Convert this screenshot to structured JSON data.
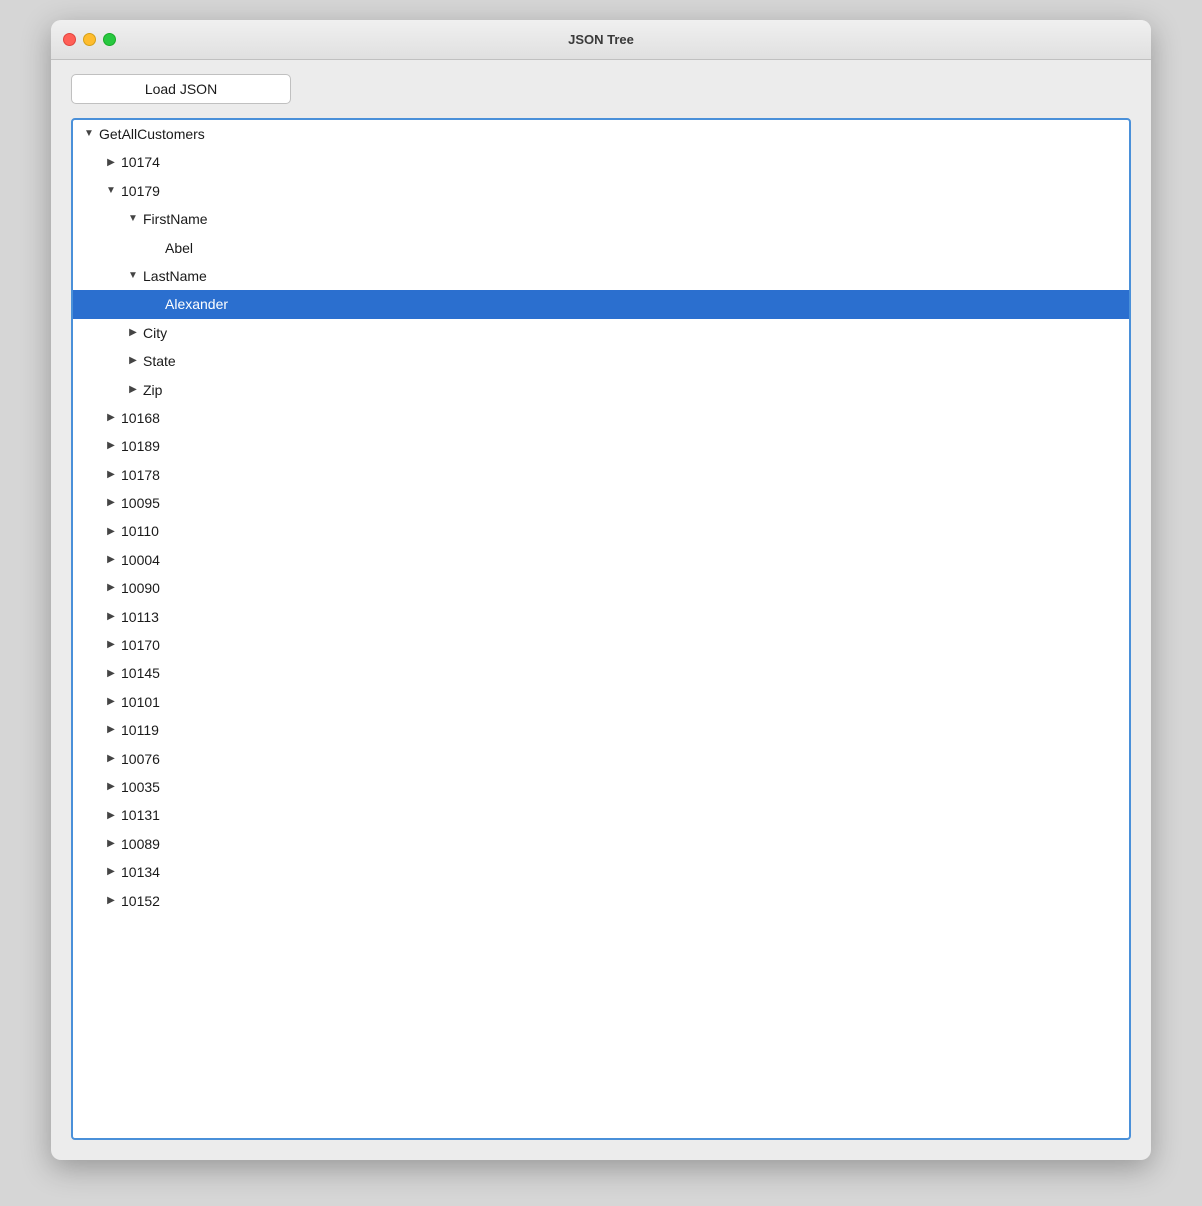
{
  "window": {
    "title": "JSON Tree"
  },
  "toolbar": {
    "load_button_label": "Load JSON"
  },
  "tree": {
    "items": [
      {
        "id": "GetAllCustomers",
        "label": "GetAllCustomers",
        "arrow": "expanded",
        "indent": 0,
        "selected": false
      },
      {
        "id": "10174",
        "label": "10174",
        "arrow": "collapsed",
        "indent": 1,
        "selected": false
      },
      {
        "id": "10179",
        "label": "10179",
        "arrow": "expanded",
        "indent": 1,
        "selected": false
      },
      {
        "id": "FirstName",
        "label": "FirstName",
        "arrow": "expanded",
        "indent": 2,
        "selected": false
      },
      {
        "id": "Abel",
        "label": "Abel",
        "arrow": "none",
        "indent": 3,
        "selected": false
      },
      {
        "id": "LastName",
        "label": "LastName",
        "arrow": "expanded",
        "indent": 2,
        "selected": false
      },
      {
        "id": "Alexander",
        "label": "Alexander",
        "arrow": "none",
        "indent": 3,
        "selected": true
      },
      {
        "id": "City",
        "label": "City",
        "arrow": "collapsed",
        "indent": 2,
        "selected": false
      },
      {
        "id": "State",
        "label": "State",
        "arrow": "collapsed",
        "indent": 2,
        "selected": false
      },
      {
        "id": "Zip",
        "label": "Zip",
        "arrow": "collapsed",
        "indent": 2,
        "selected": false
      },
      {
        "id": "10168",
        "label": "10168",
        "arrow": "collapsed",
        "indent": 1,
        "selected": false
      },
      {
        "id": "10189",
        "label": "10189",
        "arrow": "collapsed",
        "indent": 1,
        "selected": false
      },
      {
        "id": "10178",
        "label": "10178",
        "arrow": "collapsed",
        "indent": 1,
        "selected": false
      },
      {
        "id": "10095",
        "label": "10095",
        "arrow": "collapsed",
        "indent": 1,
        "selected": false
      },
      {
        "id": "10110",
        "label": "10110",
        "arrow": "collapsed",
        "indent": 1,
        "selected": false
      },
      {
        "id": "10004",
        "label": "10004",
        "arrow": "collapsed",
        "indent": 1,
        "selected": false
      },
      {
        "id": "10090",
        "label": "10090",
        "arrow": "collapsed",
        "indent": 1,
        "selected": false
      },
      {
        "id": "10113",
        "label": "10113",
        "arrow": "collapsed",
        "indent": 1,
        "selected": false
      },
      {
        "id": "10170",
        "label": "10170",
        "arrow": "collapsed",
        "indent": 1,
        "selected": false
      },
      {
        "id": "10145",
        "label": "10145",
        "arrow": "collapsed",
        "indent": 1,
        "selected": false
      },
      {
        "id": "10101",
        "label": "10101",
        "arrow": "collapsed",
        "indent": 1,
        "selected": false
      },
      {
        "id": "10119",
        "label": "10119",
        "arrow": "collapsed",
        "indent": 1,
        "selected": false
      },
      {
        "id": "10076",
        "label": "10076",
        "arrow": "collapsed",
        "indent": 1,
        "selected": false
      },
      {
        "id": "10035",
        "label": "10035",
        "arrow": "collapsed",
        "indent": 1,
        "selected": false
      },
      {
        "id": "10131",
        "label": "10131",
        "arrow": "collapsed",
        "indent": 1,
        "selected": false
      },
      {
        "id": "10089",
        "label": "10089",
        "arrow": "collapsed",
        "indent": 1,
        "selected": false
      },
      {
        "id": "10134",
        "label": "10134",
        "arrow": "collapsed",
        "indent": 1,
        "selected": false
      },
      {
        "id": "10152",
        "label": "10152",
        "arrow": "collapsed",
        "indent": 1,
        "selected": false
      }
    ]
  }
}
